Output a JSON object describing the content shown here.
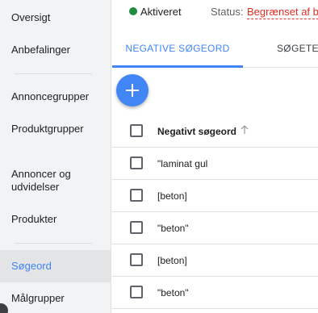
{
  "sidebar": {
    "items": [
      {
        "label": "Oversigt"
      },
      {
        "label": "Anbefalinger"
      },
      {
        "label": "Annoncegrupper"
      },
      {
        "label": "Produktgrupper"
      },
      {
        "label": "Annoncer og udvidelser"
      },
      {
        "label": "Produkter"
      },
      {
        "label": "Søgeord"
      },
      {
        "label": "Målgrupper"
      }
    ],
    "active_item": "Søgeord"
  },
  "status_bar": {
    "state": "Aktiveret",
    "status_label": "Status:",
    "status_value": "Begrænset af b"
  },
  "tabs": [
    {
      "label": "NEGATIVE SØGEORD",
      "active": true
    },
    {
      "label": "SØGETER",
      "active": false
    }
  ],
  "table": {
    "header": "Negativt søgeord",
    "rows": [
      {
        "keyword": "\"laminat gul"
      },
      {
        "keyword": "[beton]"
      },
      {
        "keyword": "\"beton\""
      },
      {
        "keyword": "[beton]"
      },
      {
        "keyword": "\"beton\""
      }
    ]
  },
  "colors": {
    "accent": "#4285f4",
    "status_green": "#1e8e3e",
    "status_red": "#d93025",
    "sidebar_bg": "#f1f3f4"
  },
  "icons": {
    "fab": "plus-icon",
    "sort": "arrow-up-icon",
    "status": "status-dot-icon"
  }
}
